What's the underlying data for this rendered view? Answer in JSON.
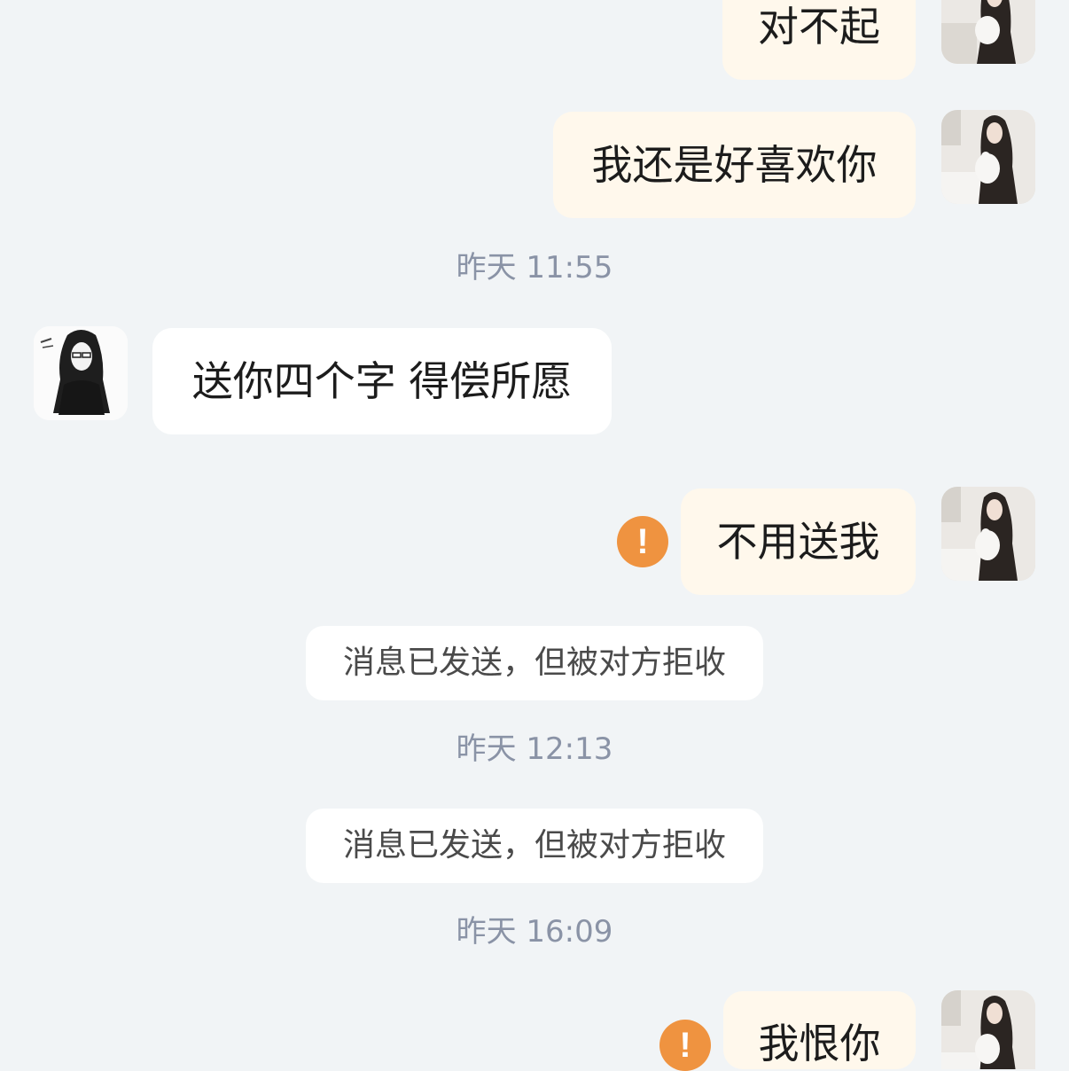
{
  "colors": {
    "background": "#f1f4f6",
    "outgoing_bubble": "#fff8ec",
    "incoming_bubble": "#ffffff",
    "system_pill": "#ffffff",
    "timestamp_text": "#8a93a6",
    "warning": "#ef9340"
  },
  "messages": [
    {
      "side": "out",
      "text": "对不起"
    },
    {
      "side": "out",
      "text": "我还是好喜欢你"
    },
    {
      "side": "in",
      "text": "送你四个字 得偿所愿"
    },
    {
      "side": "out",
      "text": "不用送我",
      "failed": true
    },
    {
      "side": "out",
      "text": "我恨你",
      "failed": true
    }
  ],
  "timestamps": [
    "昨天 11:55",
    "昨天 12:13",
    "昨天 16:09"
  ],
  "system_notices": [
    "消息已发送，但被对方拒收",
    "消息已发送，但被对方拒收"
  ],
  "icons": {
    "warning": "exclamation-circle-icon",
    "warning_glyph": "!",
    "my_avatar": "user-avatar-photo",
    "contact_avatar": "contact-avatar-sketch"
  }
}
